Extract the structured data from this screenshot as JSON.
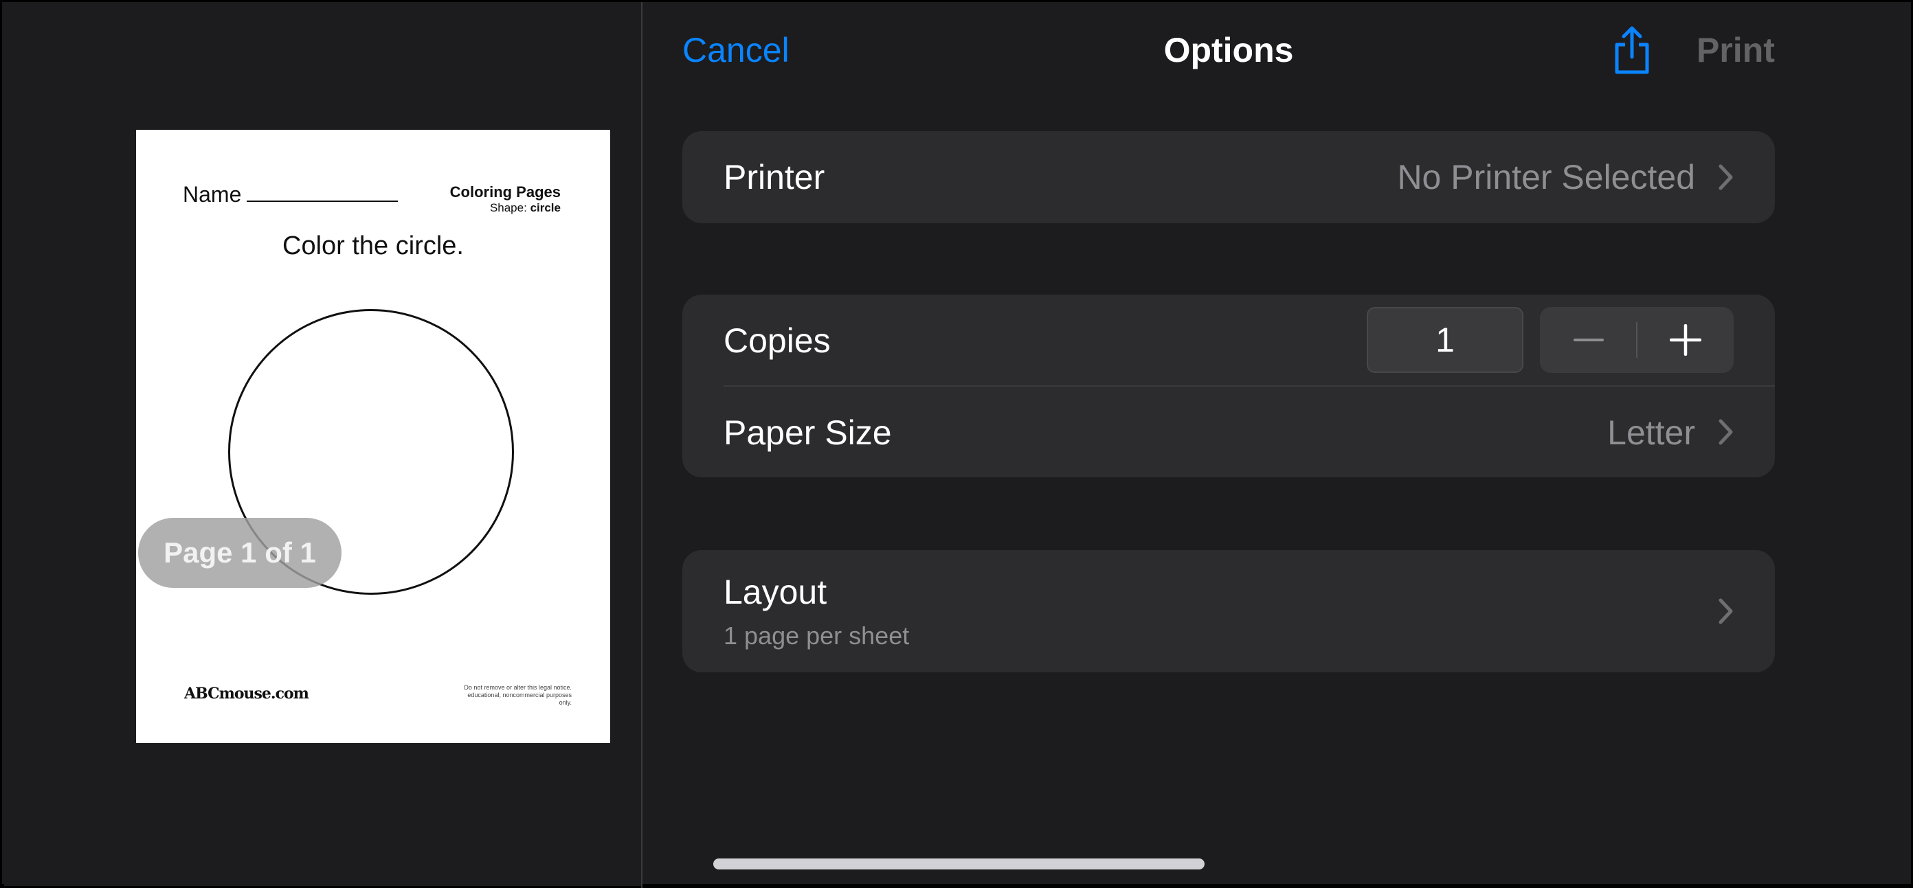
{
  "preview": {
    "sheet": {
      "name_label": "Name",
      "series": "Coloring Pages",
      "shape_label": "Shape:",
      "shape_value": "circle",
      "instruction": "Color the circle.",
      "logo": "ABCmouse.com",
      "legal": "Do not remove or alter this legal notice. educational, noncommercial purposes only."
    },
    "page_badge": "Page 1 of 1"
  },
  "nav": {
    "cancel": "Cancel",
    "title": "Options",
    "share_icon": "share-icon",
    "print": "Print"
  },
  "printer": {
    "label": "Printer",
    "value": "No Printer Selected"
  },
  "copies": {
    "label": "Copies",
    "value": "1"
  },
  "paper_size": {
    "label": "Paper Size",
    "value": "Letter"
  },
  "layout": {
    "label": "Layout",
    "subtitle": "1 page per sheet"
  },
  "colors": {
    "accent": "#0a84ff",
    "background": "#1c1c1e",
    "group": "#2c2c2e",
    "secondary_text": "#8e8e93"
  }
}
